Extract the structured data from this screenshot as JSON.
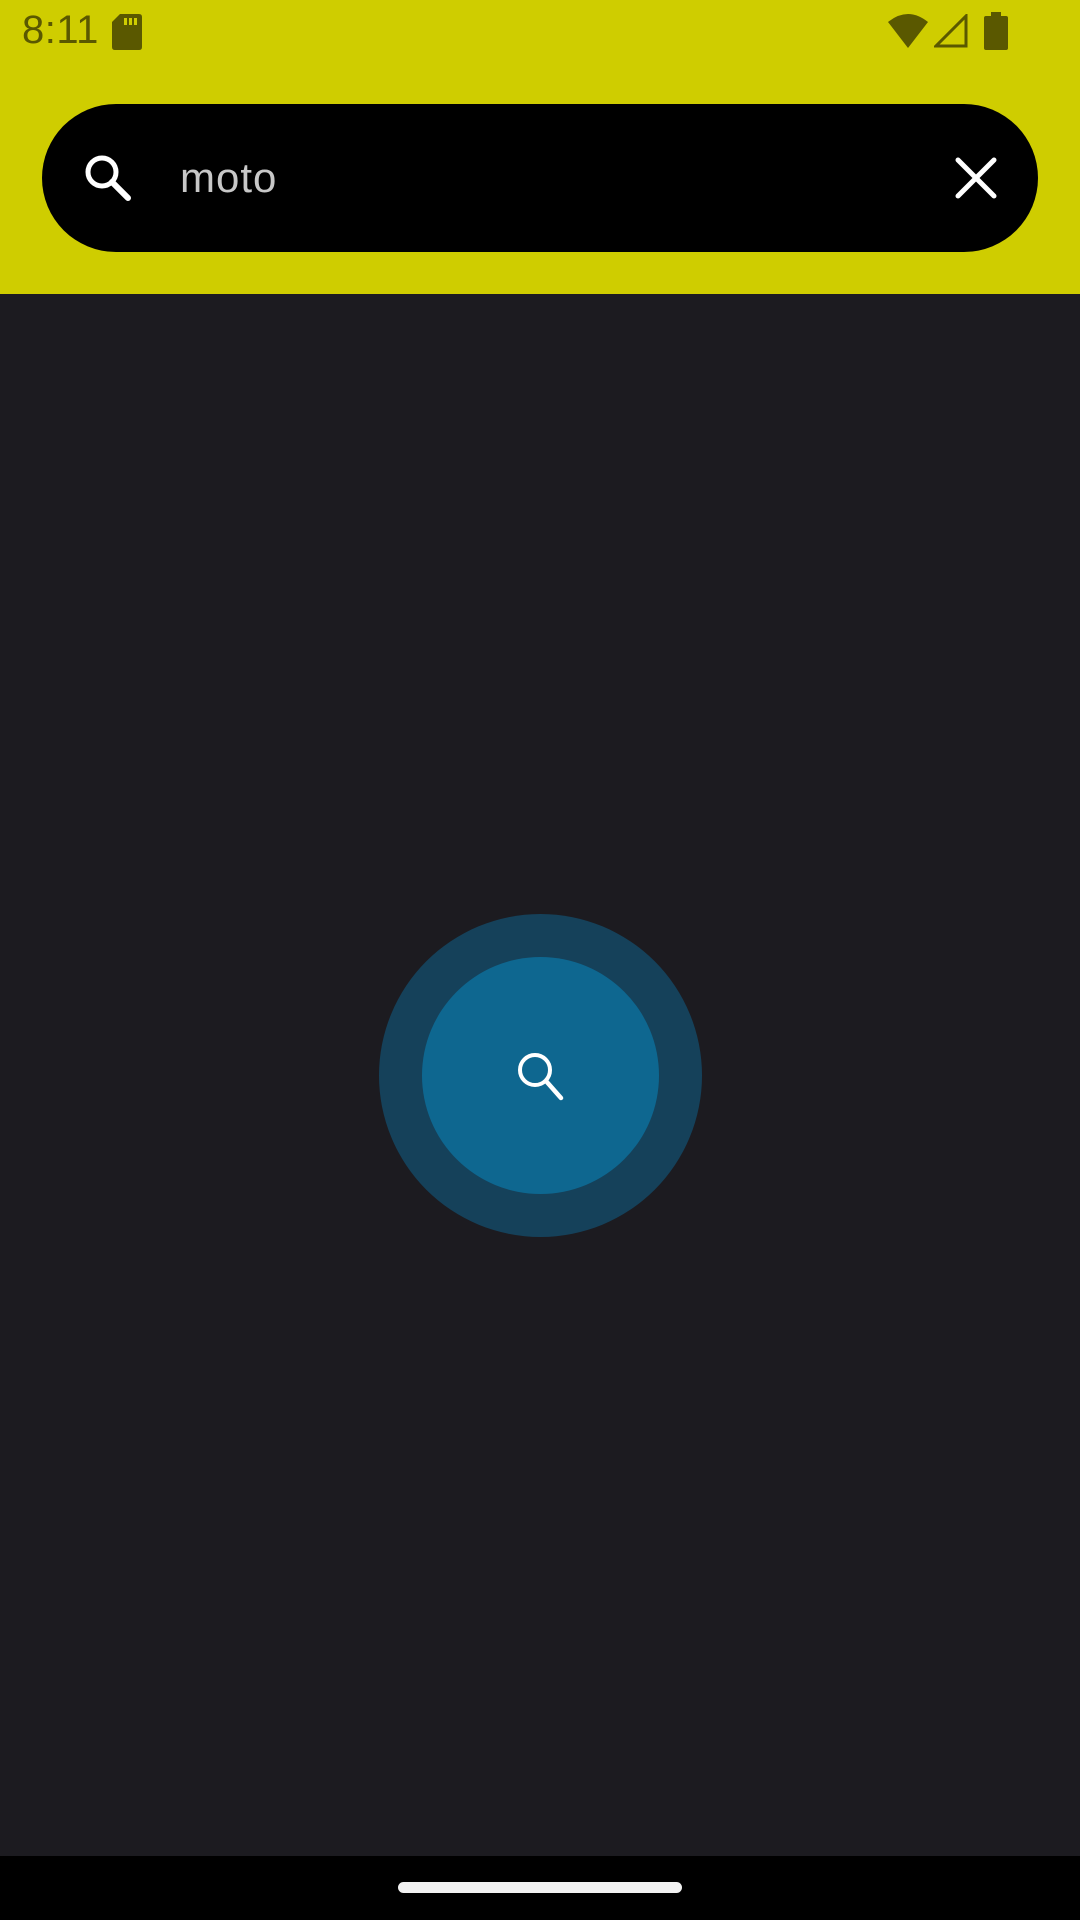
{
  "status_bar": {
    "time": "8:11",
    "icons": [
      "sd-card-icon",
      "wifi-icon",
      "cellular-signal-icon",
      "battery-icon"
    ]
  },
  "search": {
    "value": "moto",
    "placeholder": "",
    "leading_icon": "search-icon",
    "trailing_icon": "close-icon"
  },
  "center_action": {
    "icon": "search-icon"
  },
  "colors": {
    "header": "#cfcd00",
    "background": "#1c1b20",
    "search_bar": "#000000",
    "fab": "#0e6790",
    "fab_halo": "#15415a"
  }
}
